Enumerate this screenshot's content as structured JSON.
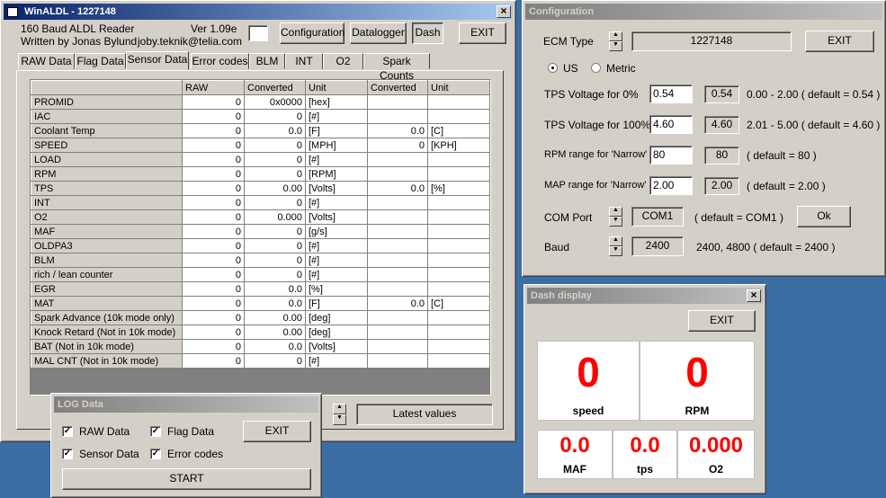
{
  "main": {
    "title": "WinALDL - 1227148",
    "subtitle1": "160 Baud ALDL Reader",
    "subtitle2": "Written by Jonas Bylund",
    "version": "Ver 1.09e",
    "email": "joby.teknik@telia.com",
    "buttons": {
      "configuration": "Configuration",
      "datalogger": "Datalogger",
      "dash": "Dash",
      "exit": "EXIT"
    },
    "tabs": [
      "RAW Data",
      "Flag Data",
      "Sensor Data",
      "Error codes",
      "BLM",
      "INT",
      "O2",
      "Spark Counts"
    ],
    "selected_tab": "Sensor Data",
    "columns": [
      "",
      "RAW",
      "Converted",
      "Unit",
      "Converted",
      "Unit"
    ],
    "rows": [
      {
        "name": "PROMID",
        "raw": "0",
        "conv": "0x0000",
        "unit": "[hex]",
        "conv2": "",
        "unit2": ""
      },
      {
        "name": "IAC",
        "raw": "0",
        "conv": "0",
        "unit": "[#]",
        "conv2": "",
        "unit2": ""
      },
      {
        "name": "Coolant Temp",
        "raw": "0",
        "conv": "0.0",
        "unit": "[F]",
        "conv2": "0.0",
        "unit2": "[C]"
      },
      {
        "name": "SPEED",
        "raw": "0",
        "conv": "0",
        "unit": "[MPH]",
        "conv2": "0",
        "unit2": "[KPH]"
      },
      {
        "name": "LOAD",
        "raw": "0",
        "conv": "0",
        "unit": "[#]",
        "conv2": "",
        "unit2": ""
      },
      {
        "name": "RPM",
        "raw": "0",
        "conv": "0",
        "unit": "[RPM]",
        "conv2": "",
        "unit2": ""
      },
      {
        "name": "TPS",
        "raw": "0",
        "conv": "0.00",
        "unit": "[Volts]",
        "conv2": "0.0",
        "unit2": "[%]"
      },
      {
        "name": "INT",
        "raw": "0",
        "conv": "0",
        "unit": "[#]",
        "conv2": "",
        "unit2": ""
      },
      {
        "name": "O2",
        "raw": "0",
        "conv": "0.000",
        "unit": "[Volts]",
        "conv2": "",
        "unit2": ""
      },
      {
        "name": "MAF",
        "raw": "0",
        "conv": "0",
        "unit": "[g/s]",
        "conv2": "",
        "unit2": ""
      },
      {
        "name": "OLDPA3",
        "raw": "0",
        "conv": "0",
        "unit": "[#]",
        "conv2": "",
        "unit2": ""
      },
      {
        "name": "BLM",
        "raw": "0",
        "conv": "0",
        "unit": "[#]",
        "conv2": "",
        "unit2": ""
      },
      {
        "name": "rich / lean counter",
        "raw": "0",
        "conv": "0",
        "unit": "[#]",
        "conv2": "",
        "unit2": ""
      },
      {
        "name": "EGR",
        "raw": "0",
        "conv": "0.0",
        "unit": "[%]",
        "conv2": "",
        "unit2": ""
      },
      {
        "name": "MAT",
        "raw": "0",
        "conv": "0.0",
        "unit": "[F]",
        "conv2": "0.0",
        "unit2": "[C]"
      },
      {
        "name": "Spark Advance (10k mode only)",
        "raw": "0",
        "conv": "0.00",
        "unit": "[deg]",
        "conv2": "",
        "unit2": ""
      },
      {
        "name": "Knock Retard (Not in 10k mode)",
        "raw": "0",
        "conv": "0.00",
        "unit": "[deg]",
        "conv2": "",
        "unit2": ""
      },
      {
        "name": "BAT (Not in 10k mode)",
        "raw": "0",
        "conv": "0.0",
        "unit": "[Volts]",
        "conv2": "",
        "unit2": ""
      },
      {
        "name": "MAL CNT (Not in 10k mode)",
        "raw": "0",
        "conv": "0",
        "unit": "[#]",
        "conv2": "",
        "unit2": ""
      }
    ],
    "latest_values": "Latest values"
  },
  "log": {
    "title": "LOG Data",
    "raw_data": "RAW Data",
    "flag_data": "Flag Data",
    "sensor_data": "Sensor Data",
    "error_codes": "Error codes",
    "exit": "EXIT",
    "start": "START"
  },
  "config": {
    "title": "Configuration",
    "ecm_type_label": "ECM Type",
    "ecm_type_value": "1227148",
    "exit": "EXIT",
    "us": "US",
    "metric": "Metric",
    "tps0_label": "TPS Voltage for 0%",
    "tps0_input": "0.54",
    "tps0_current": "0.54",
    "tps0_hint": "0.00 - 2.00  ( default = 0.54 )",
    "tps100_label": "TPS Voltage for 100%",
    "tps100_input": "4.60",
    "tps100_current": "4.60",
    "tps100_hint": "2.01 - 5.00  ( default = 4.60 )",
    "rpm_label": "RPM range for 'Narrow'",
    "rpm_input": "80",
    "rpm_current": "80",
    "rpm_hint": "( default = 80 )",
    "map_label": "MAP range for 'Narrow'",
    "map_input": "2.00",
    "map_current": "2.00",
    "map_hint": "( default = 2.00 )",
    "com_label": "COM Port",
    "com_value": "COM1",
    "com_hint": "( default = COM1 )",
    "ok": "Ok",
    "baud_label": "Baud",
    "baud_value": "2400",
    "baud_hint": "2400, 4800  ( default = 2400 )"
  },
  "dash": {
    "title": "Dash display",
    "exit": "EXIT",
    "speed_value": "0",
    "speed_label": "speed",
    "rpm_value": "0",
    "rpm_label": "RPM",
    "maf_value": "0.0",
    "maf_label": "MAF",
    "tps_value": "0.0",
    "tps_label": "tps",
    "o2_value": "0.000",
    "o2_label": "O2"
  }
}
